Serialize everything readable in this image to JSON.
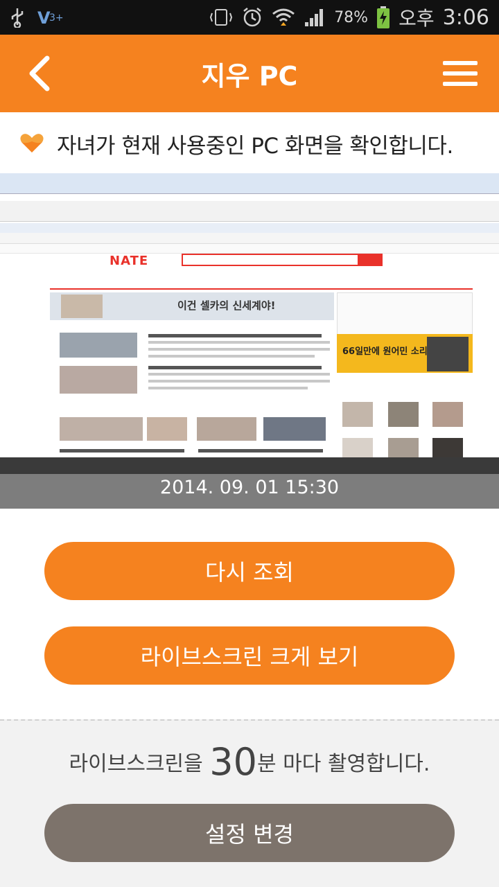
{
  "status_bar": {
    "battery": "78%",
    "time_prefix": "오후",
    "time": "3:06"
  },
  "app_bar": {
    "title": "지우 PC"
  },
  "subtitle": "자녀가 현재 사용중인 PC 화면을 확인합니다.",
  "preview": {
    "date_time": "2014. 09. 01  15:30",
    "logo": "NATE",
    "ad_text": "이건 셀카의 신세계야!",
    "side_ad_text": "66일만에 원어민 소리가"
  },
  "buttons": {
    "refresh": "다시 조회",
    "fullscreen": "라이브스크린 크게 보기",
    "settings": "설정 변경"
  },
  "interval": {
    "prefix": "라이브스크린을 ",
    "minutes": "30",
    "suffix": "분 마다 촬영합니다."
  },
  "colors": {
    "accent": "#f5821f",
    "secondary_button": "#7d736b"
  }
}
